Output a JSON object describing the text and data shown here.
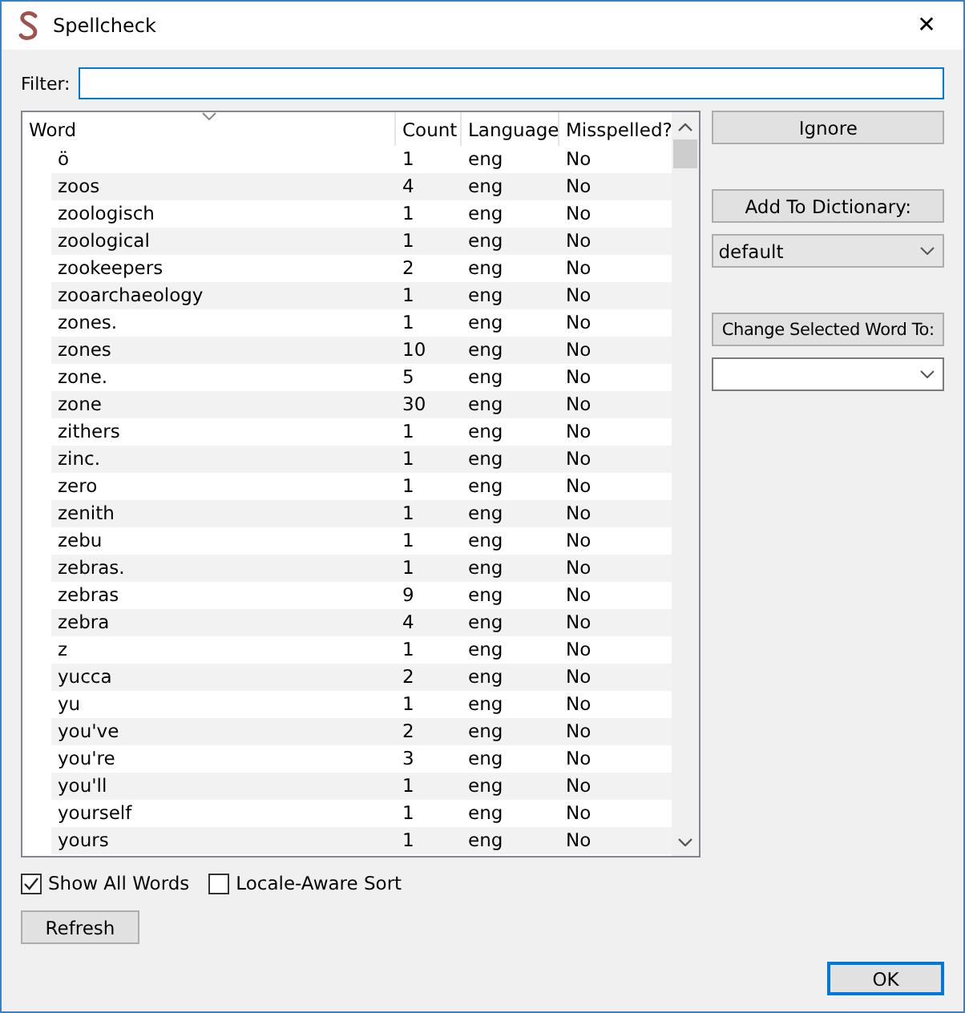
{
  "window": {
    "title": "Spellcheck",
    "close": "✕"
  },
  "filter": {
    "label": "Filter:"
  },
  "table": {
    "columns": [
      "Word",
      "Count",
      "Language",
      "Misspelled?"
    ],
    "rows": [
      [
        "ö",
        "1",
        "eng",
        "No"
      ],
      [
        "zoos",
        "4",
        "eng",
        "No"
      ],
      [
        "zoologisch",
        "1",
        "eng",
        "No"
      ],
      [
        "zoological",
        "1",
        "eng",
        "No"
      ],
      [
        "zookeepers",
        "2",
        "eng",
        "No"
      ],
      [
        "zooarchaeology",
        "1",
        "eng",
        "No"
      ],
      [
        "zones.",
        "1",
        "eng",
        "No"
      ],
      [
        "zones",
        "10",
        "eng",
        "No"
      ],
      [
        "zone.",
        "5",
        "eng",
        "No"
      ],
      [
        "zone",
        "30",
        "eng",
        "No"
      ],
      [
        "zithers",
        "1",
        "eng",
        "No"
      ],
      [
        "zinc.",
        "1",
        "eng",
        "No"
      ],
      [
        "zero",
        "1",
        "eng",
        "No"
      ],
      [
        "zenith",
        "1",
        "eng",
        "No"
      ],
      [
        "zebu",
        "1",
        "eng",
        "No"
      ],
      [
        "zebras.",
        "1",
        "eng",
        "No"
      ],
      [
        "zebras",
        "9",
        "eng",
        "No"
      ],
      [
        "zebra",
        "4",
        "eng",
        "No"
      ],
      [
        "z",
        "1",
        "eng",
        "No"
      ],
      [
        "yucca",
        "2",
        "eng",
        "No"
      ],
      [
        "yu",
        "1",
        "eng",
        "No"
      ],
      [
        "you've",
        "2",
        "eng",
        "No"
      ],
      [
        "you're",
        "3",
        "eng",
        "No"
      ],
      [
        "you'll",
        "1",
        "eng",
        "No"
      ],
      [
        "yourself",
        "1",
        "eng",
        "No"
      ],
      [
        "yours",
        "1",
        "eng",
        "No"
      ]
    ]
  },
  "actions": {
    "ignore": "Ignore",
    "add": "Add To Dictionary:",
    "dictionary": "default",
    "change": "Change Selected Word To:"
  },
  "options": [
    {
      "label": "Show All Words",
      "checked": true
    },
    {
      "label": "Locale-Aware Sort",
      "checked": false
    }
  ],
  "refresh": "Refresh",
  "ok": "OK"
}
